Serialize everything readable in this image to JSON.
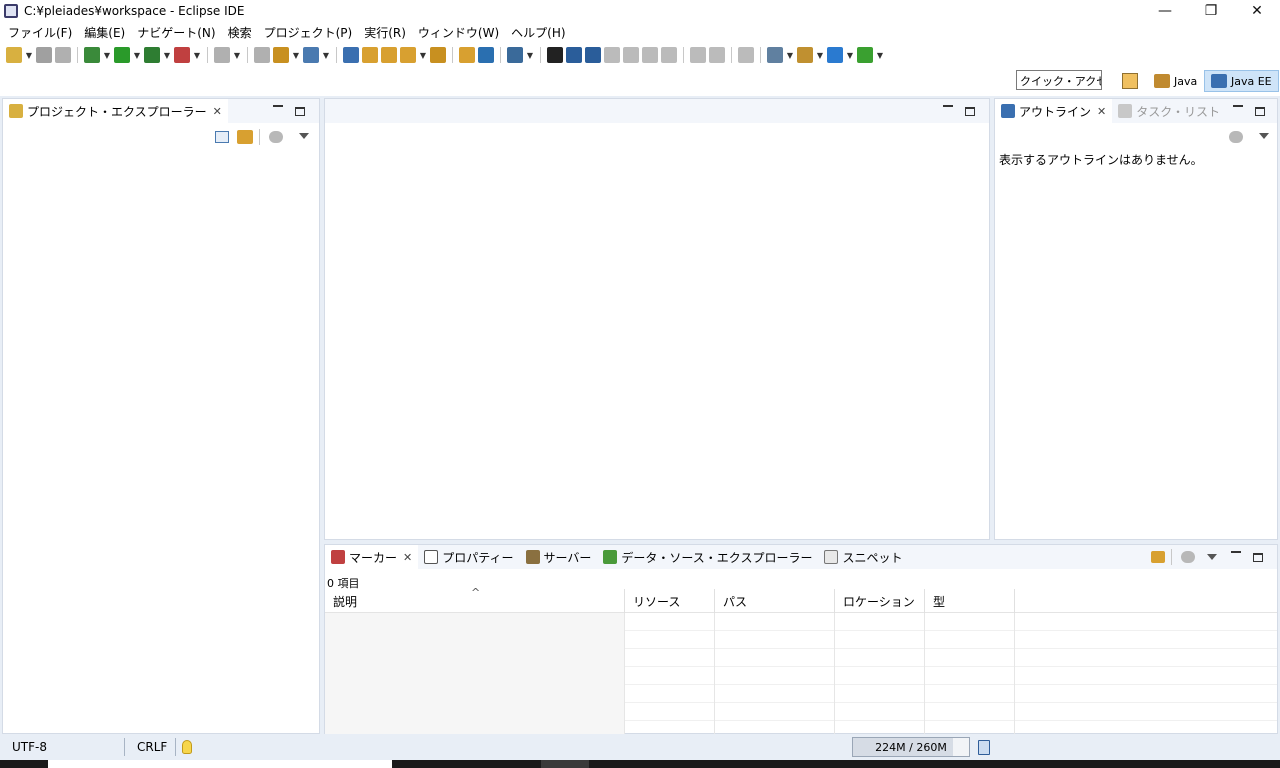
{
  "window": {
    "title": "C:¥pleiades¥workspace - Eclipse IDE",
    "controls": {
      "minimize": "—",
      "restore": "❐",
      "close": "✕"
    }
  },
  "menu": [
    "ファイル(F)",
    "編集(E)",
    "ナビゲート(N)",
    "検索",
    "プロジェクト(P)",
    "実行(R)",
    "ウィンドウ(W)",
    "ヘルプ(H)"
  ],
  "toolbar": {
    "icon_colors": [
      "#d8b040",
      "#a0a0a0",
      "#b0b0b0",
      "#3a8a3a",
      "#2a9a2a",
      "#2e7d32",
      "#c04040",
      "#b0b0b0",
      "#b0b0b0",
      "#c89020",
      "#4a7ab0",
      "#3a6fb0",
      "#d8a030",
      "#d8a030",
      "#d8a030",
      "#c89020",
      "#d8a030",
      "#2a6fb0",
      "#3a6a9a",
      "#222222",
      "#2a5d9a",
      "#2a5d9a",
      "#bbbbbb",
      "#bbbbbb",
      "#bbbbbb",
      "#bbbbbb",
      "#bbbbbb",
      "#bbbbbb",
      "#bbbbbb",
      "#6080a0",
      "#c09030",
      "#2a7ad0",
      "#3aa030",
      "#bbbbbb",
      "#bbbbbb",
      "#bbbbbb",
      "#bbbbbb",
      "#bbbbbb"
    ]
  },
  "perspectives": {
    "quick_access": "クイック・アクセス",
    "java": "Java",
    "java_ee": "Java EE"
  },
  "project_explorer": {
    "tab": "プロジェクト・エクスプローラー"
  },
  "outline": {
    "tab": "アウトライン",
    "tab2": "タスク・リスト",
    "empty_message": "表示するアウトラインはありません。"
  },
  "bottom_panel": {
    "tabs": [
      "マーカー",
      "プロパティー",
      "サーバー",
      "データ・ソース・エクスプローラー",
      "スニペット"
    ],
    "count": "0 項目",
    "columns": [
      "説明",
      "リソース",
      "パス",
      "ロケーション",
      "型"
    ],
    "sort_indicator": "^"
  },
  "status": {
    "encoding": "UTF-8",
    "line_ending": "CRLF",
    "heap": "224M / 260M",
    "heap_fraction": 0.862
  },
  "colors": {
    "accent_selected": "#cfe4f8",
    "panel_border": "#d4dbe6",
    "background": "#e8eef6"
  }
}
